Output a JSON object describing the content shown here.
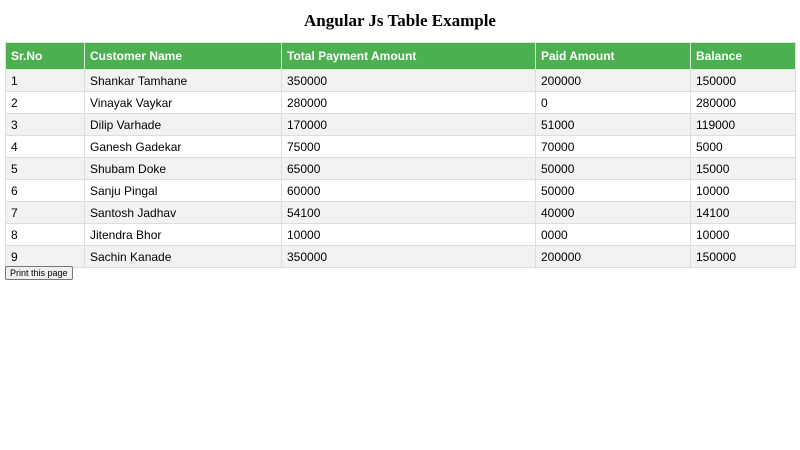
{
  "page": {
    "title": "Angular Js Table Example"
  },
  "table": {
    "columns": [
      "Sr.No",
      "Customer Name",
      "Total Payment Amount",
      "Paid Amount",
      "Balance"
    ],
    "rows": [
      [
        "1",
        "Shankar Tamhane",
        "350000",
        "200000",
        "150000"
      ],
      [
        "2",
        "Vinayak Vaykar",
        "280000",
        "0",
        "280000"
      ],
      [
        "3",
        "Dilip Varhade",
        "170000",
        "51000",
        "119000"
      ],
      [
        "4",
        "Ganesh Gadekar",
        "75000",
        "70000",
        "5000"
      ],
      [
        "5",
        "Shubam Doke",
        "65000",
        "50000",
        "15000"
      ],
      [
        "6",
        "Sanju Pingal",
        "60000",
        "50000",
        "10000"
      ],
      [
        "7",
        "Santosh Jadhav",
        "54100",
        "40000",
        "14100"
      ],
      [
        "8",
        "Jitendra Bhor",
        "10000",
        "0000",
        "10000"
      ],
      [
        "9",
        "Sachin Kanade",
        "350000",
        "200000",
        "150000"
      ]
    ]
  },
  "actions": {
    "print_label": "Print this page"
  },
  "colors": {
    "header_bg": "#4caf50",
    "header_text": "#ffffff",
    "stripe_row": "#f2f2f2",
    "border": "#dddddd"
  }
}
